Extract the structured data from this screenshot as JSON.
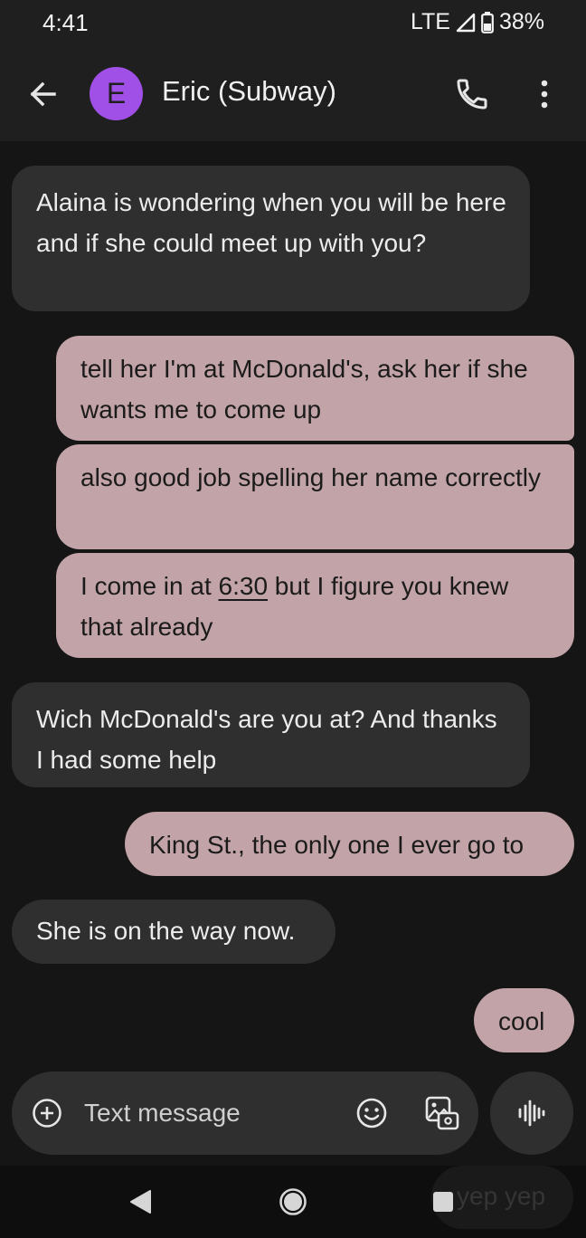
{
  "status_bar": {
    "time": "4:41",
    "network": "LTE",
    "battery": "38%"
  },
  "header": {
    "avatar_letter": "E",
    "avatar_color": "#a050e6",
    "contact_name": "Eric (Subway)"
  },
  "messages": [
    {
      "direction": "incoming",
      "text": "Alaina is wondering when you will be here and if she could meet up with you?"
    },
    {
      "direction": "outgoing",
      "text": "tell her I'm at McDonald's, ask her if she wants me to come up"
    },
    {
      "direction": "outgoing",
      "text": "also good job spelling her name correctly"
    },
    {
      "direction": "outgoing",
      "text_before": "I come in at ",
      "text_link": "6:30",
      "text_after": " but I figure you knew that already"
    },
    {
      "direction": "incoming",
      "text": "Wich McDonald's are you at? And thanks I had some help"
    },
    {
      "direction": "outgoing",
      "text": "King St., the only one I ever go to"
    },
    {
      "direction": "incoming",
      "text": "She is on the way now."
    },
    {
      "direction": "outgoing",
      "text": "cool"
    }
  ],
  "compose": {
    "placeholder": "Text message",
    "smart_reply": "yep yep"
  },
  "colors": {
    "incoming_bubble": "#2f2f2f",
    "outgoing_bubble": "#c2a3a7",
    "background": "#151515"
  }
}
